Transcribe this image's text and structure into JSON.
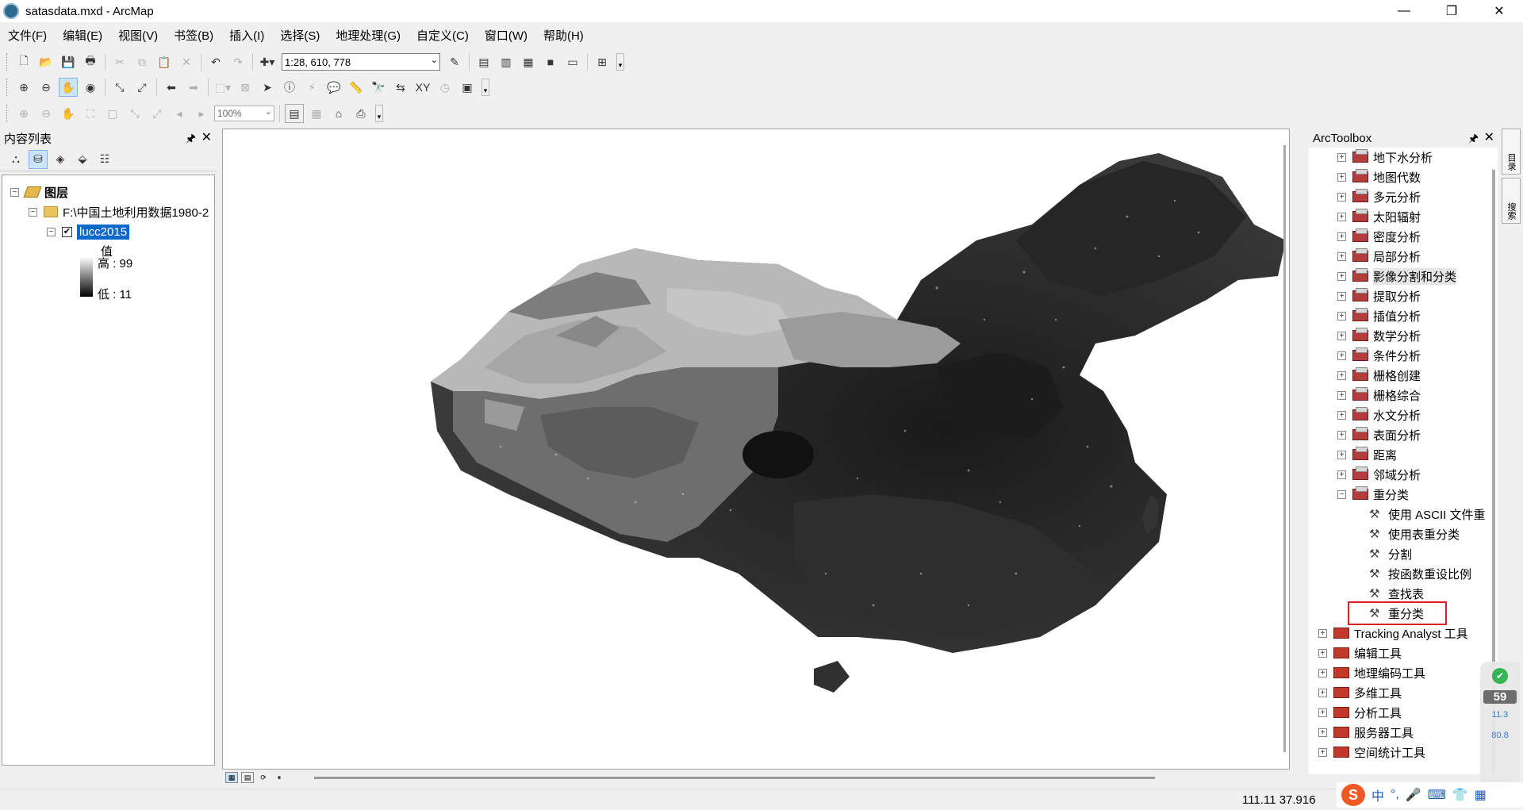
{
  "window": {
    "title": "satasdata.mxd - ArcMap"
  },
  "menu": [
    "文件(F)",
    "编辑(E)",
    "视图(V)",
    "书签(B)",
    "插入(I)",
    "选择(S)",
    "地理处理(G)",
    "自定义(C)",
    "窗口(W)",
    "帮助(H)"
  ],
  "toolbar": {
    "scale": "1:28, 610, 778",
    "zoom": "100%"
  },
  "toc": {
    "title": "内容列表",
    "root": "图层",
    "folder": "F:\\中国土地利用数据1980-2",
    "layer": "lucc2015",
    "legend_field": "值",
    "legend_high": "高 : 99",
    "legend_low": "低 : 11"
  },
  "arctoolbox": {
    "title": "ArcToolbox",
    "spatial_analyst": [
      "地下水分析",
      "地图代数",
      "多元分析",
      "太阳辐射",
      "密度分析",
      "局部分析",
      "影像分割和分类",
      "提取分析",
      "插值分析",
      "数学分析",
      "条件分析",
      "栅格创建",
      "栅格综合",
      "水文分析",
      "表面分析",
      "距离",
      "邻域分析",
      "重分类"
    ],
    "reclass_tools": [
      "使用 ASCII 文件重",
      "使用表重分类",
      "分割",
      "按函数重设比例",
      "查找表",
      "重分类"
    ],
    "toolboxes": [
      "Tracking Analyst 工具",
      "编辑工具",
      "地理编码工具",
      "多维工具",
      "分析工具",
      "服务器工具",
      "空间统计工具"
    ]
  },
  "sidetabs": [
    "目录",
    "搜索"
  ],
  "status": {
    "coords": "111.11  37.916"
  },
  "ime": {
    "chars": [
      "中",
      "°,"
    ]
  },
  "widget": {
    "pct": "59",
    "up": "11.3",
    "down": "80.8"
  }
}
